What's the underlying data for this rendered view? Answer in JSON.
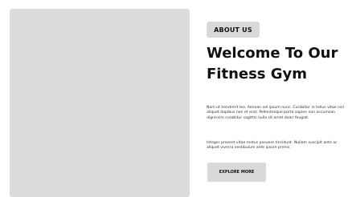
{
  "about": {
    "badge_label": "ABOUT US",
    "title": "Welcome To Our Fitness Gym",
    "paragraphs": [
      "Nam ut hendrerit leo. Aenean vel ipsum nunc. Curabitur in tellus vitae nisl aliquet dapibus non et erat. Pellentesque porta sapien non accumsan dignissim curabitur sagittis nulla sit amet dolor feugiat.",
      "Integer prosent vitae metus posuere tincidunt. Nullam suscipit ante ac aliquet viverra vestibulum ante ipsum primis."
    ],
    "cta_label": "EXPLORE MORE"
  }
}
